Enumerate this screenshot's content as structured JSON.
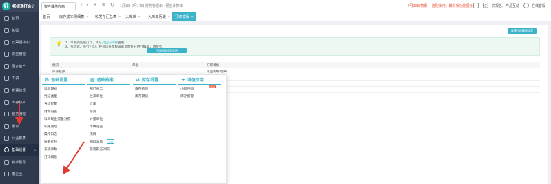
{
  "app": {
    "logo_text": "畅捷通好会计",
    "logo_mark": "好"
  },
  "sidebar": {
    "items": [
      {
        "label": "首页"
      },
      {
        "label": "总账"
      },
      {
        "label": "云票据中心"
      },
      {
        "label": "资金管理"
      },
      {
        "label": "固定资产"
      },
      {
        "label": "工资"
      },
      {
        "label": "发票管理"
      },
      {
        "label": "库存核算"
      },
      {
        "label": "税务管理"
      },
      {
        "label": "报表"
      },
      {
        "label": "行业报表"
      },
      {
        "label": "基础设置"
      },
      {
        "label": "新手引导"
      },
      {
        "label": "模企业"
      }
    ]
  },
  "topbar": {
    "company": "客户或供应商",
    "period": "1月1日-2月14日   财务管理年 • 预金计算年"
  },
  "top_right": {
    "promo": "7月30日特惠！ 选购使用，精彩新功能展示",
    "badge_letter": "企",
    "msg_label": "快报名、产品互动",
    "service_label": "在线客服",
    "user_label": "李四"
  },
  "tabs": [
    {
      "label": "首页",
      "close": ""
    },
    {
      "label": "库存成本明细表",
      "close": "×"
    },
    {
      "label": "收发存汇总表",
      "close": "×"
    },
    {
      "label": "入库单",
      "close": "×"
    },
    {
      "label": "入库单历史",
      "close": "×"
    },
    {
      "label": "打印模板",
      "close": "×"
    }
  ],
  "panel": {
    "corner_button": "找模打印模板设置",
    "tip1_a": "1、单据完成后打印，请从",
    "tip1_link": "对应的单据",
    "tip1_b": "查看。",
    "tip2": "2、多页式、多行打印，并可以在模板设置页面打开进行编辑，请参考",
    "settings_button": "打印模板设置说明",
    "columns": [
      "模块",
      "单据",
      "打印模板"
    ],
    "rows": [
      [
        "库存核算",
        "",
        "单品明细-明细"
      ],
      [
        "",
        "",
        ""
      ],
      [
        "",
        "",
        ""
      ],
      [
        "",
        "",
        ""
      ],
      [
        "",
        "",
        ""
      ],
      [
        "",
        "",
        ""
      ]
    ]
  },
  "dropdown": {
    "columns": [
      {
        "title": "基础设置",
        "icon": "⚙",
        "items": [
          "科目期初",
          "凭证类型",
          "凭证配置",
          "财务设置",
          "科目现金流量对照",
          "权限管理",
          "操作日志",
          "账套迁移",
          "系统参数",
          "打印模板"
        ]
      },
      {
        "title": "基础档案",
        "icon": "▤",
        "items": [
          "部门员工",
          "往来单位",
          "仓库",
          "存货",
          "计量单位",
          "币种设置",
          "项目",
          "物料清单",
          "存货形态对照"
        ]
      },
      {
        "title": "库存设置",
        "icon": "⇄",
        "items": [
          "库存选项",
          "库存期初"
        ]
      },
      {
        "title": "增值应用",
        "icon": "✦",
        "items": [
          "小程序码",
          "库存报警"
        ]
      }
    ],
    "new_badge": "NEW",
    "trial_badge": "试用"
  },
  "colors": {
    "accent": "#3cb3c9",
    "sidebar": "#2f3a4f",
    "promo": "#e8553e",
    "arrow": "#e03a2e"
  }
}
